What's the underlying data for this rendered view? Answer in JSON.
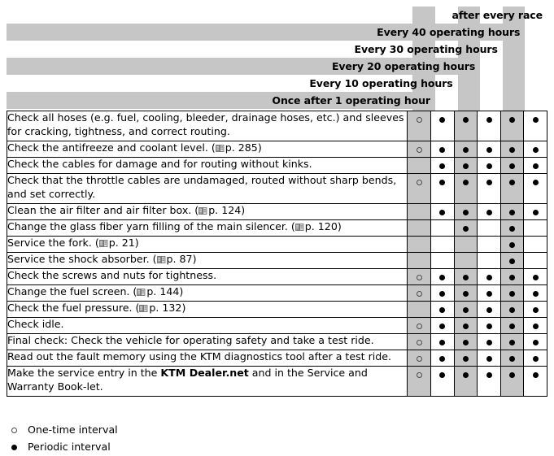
{
  "document": {
    "title": "Service schedule table",
    "icon_page_ref": "book-icon"
  },
  "colors": {
    "shade": "#c6c6c6",
    "border": "#000000",
    "text": "#000000"
  },
  "header": {
    "rows": [
      {
        "label": "after every race",
        "shaded": false,
        "span_cols": 6
      },
      {
        "label": "Every 40 operating hours",
        "shaded": true,
        "span_cols": 5
      },
      {
        "label": "Every 30 operating hours",
        "shaded": false,
        "span_cols": 4
      },
      {
        "label": "Every 20 operating hours",
        "shaded": true,
        "span_cols": 3
      },
      {
        "label": "Every 10 operating hours",
        "shaded": false,
        "span_cols": 2
      },
      {
        "label": "Once after 1 operating hour",
        "shaded": true,
        "span_cols": 1
      }
    ]
  },
  "table": {
    "column_count": 6,
    "rows": [
      {
        "task_html": "Check all hoses (e.g. fuel, cooling, bleeder, drainage hoses, etc.) and sleeves for cracking, tightness, and correct routing.",
        "task_text": "Check all hoses (e.g. fuel, cooling, bleeder, drainage hoses, etc.) and sleeves for cracking, tightness, and correct routing.",
        "page_ref": null,
        "marks": [
          "open",
          "filled",
          "filled",
          "filled",
          "filled",
          "filled"
        ],
        "tall": true
      },
      {
        "task_text": "Check the antifreeze and coolant level.",
        "page_ref": "p. 285",
        "marks": [
          "open",
          "filled",
          "filled",
          "filled",
          "filled",
          "filled"
        ],
        "tall": false
      },
      {
        "task_text": "Check the cables for damage and for routing without kinks.",
        "page_ref": null,
        "marks": [
          "none",
          "filled",
          "filled",
          "filled",
          "filled",
          "filled"
        ],
        "tall": false
      },
      {
        "task_text": "Check that the throttle cables are undamaged, routed without sharp bends, and set correctly.",
        "page_ref": null,
        "marks": [
          "open",
          "filled",
          "filled",
          "filled",
          "filled",
          "filled"
        ],
        "tall": true
      },
      {
        "task_text": "Clean the air filter and air filter box.",
        "page_ref": "p. 124",
        "marks": [
          "none",
          "filled",
          "filled",
          "filled",
          "filled",
          "filled"
        ],
        "tall": false
      },
      {
        "task_text": "Change the glass fiber yarn filling of the main silencer.",
        "page_ref": "p. 120",
        "marks": [
          "none",
          "none",
          "filled",
          "none",
          "filled",
          "none"
        ],
        "tall": false
      },
      {
        "task_text": "Service the fork.",
        "page_ref": "p. 21",
        "marks": [
          "none",
          "none",
          "none",
          "none",
          "filled",
          "none"
        ],
        "tall": false
      },
      {
        "task_text": "Service the shock absorber.",
        "page_ref": "p. 87",
        "marks": [
          "none",
          "none",
          "none",
          "none",
          "filled",
          "none"
        ],
        "tall": false
      },
      {
        "task_text": "Check the screws and nuts for tightness.",
        "page_ref": null,
        "marks": [
          "open",
          "filled",
          "filled",
          "filled",
          "filled",
          "filled"
        ],
        "tall": false
      },
      {
        "task_text": "Change the fuel screen.",
        "page_ref": "p. 144",
        "marks": [
          "open",
          "filled",
          "filled",
          "filled",
          "filled",
          "filled"
        ],
        "tall": false
      },
      {
        "task_text": "Check the fuel pressure.",
        "page_ref": "p. 132",
        "marks": [
          "none",
          "filled",
          "filled",
          "filled",
          "filled",
          "filled"
        ],
        "tall": false
      },
      {
        "task_text": "Check idle.",
        "page_ref": null,
        "marks": [
          "open",
          "filled",
          "filled",
          "filled",
          "filled",
          "filled"
        ],
        "tall": false
      },
      {
        "task_text": "Final check: Check the vehicle for operating safety and take a test ride.",
        "page_ref": null,
        "marks": [
          "open",
          "filled",
          "filled",
          "filled",
          "filled",
          "filled"
        ],
        "tall": false
      },
      {
        "task_text": "Read out the fault memory using the KTM diagnostics tool after a test ride.",
        "page_ref": null,
        "marks": [
          "open",
          "filled",
          "filled",
          "filled",
          "filled",
          "filled"
        ],
        "tall": false
      },
      {
        "task_text": "Make the service entry in the KTM Dealer.net and in the Service and Warranty Book-let.",
        "task_prefix": "Make the service entry in the ",
        "task_bold": "KTM Dealer.net",
        "task_suffix": " and in the Service and Warranty Book-let.",
        "page_ref": null,
        "marks": [
          "open",
          "filled",
          "filled",
          "filled",
          "filled",
          "filled"
        ],
        "tall": true
      }
    ]
  },
  "legend": {
    "items": [
      {
        "marker": "open",
        "label": "One-time interval"
      },
      {
        "marker": "filled",
        "label": "Periodic interval"
      }
    ]
  }
}
